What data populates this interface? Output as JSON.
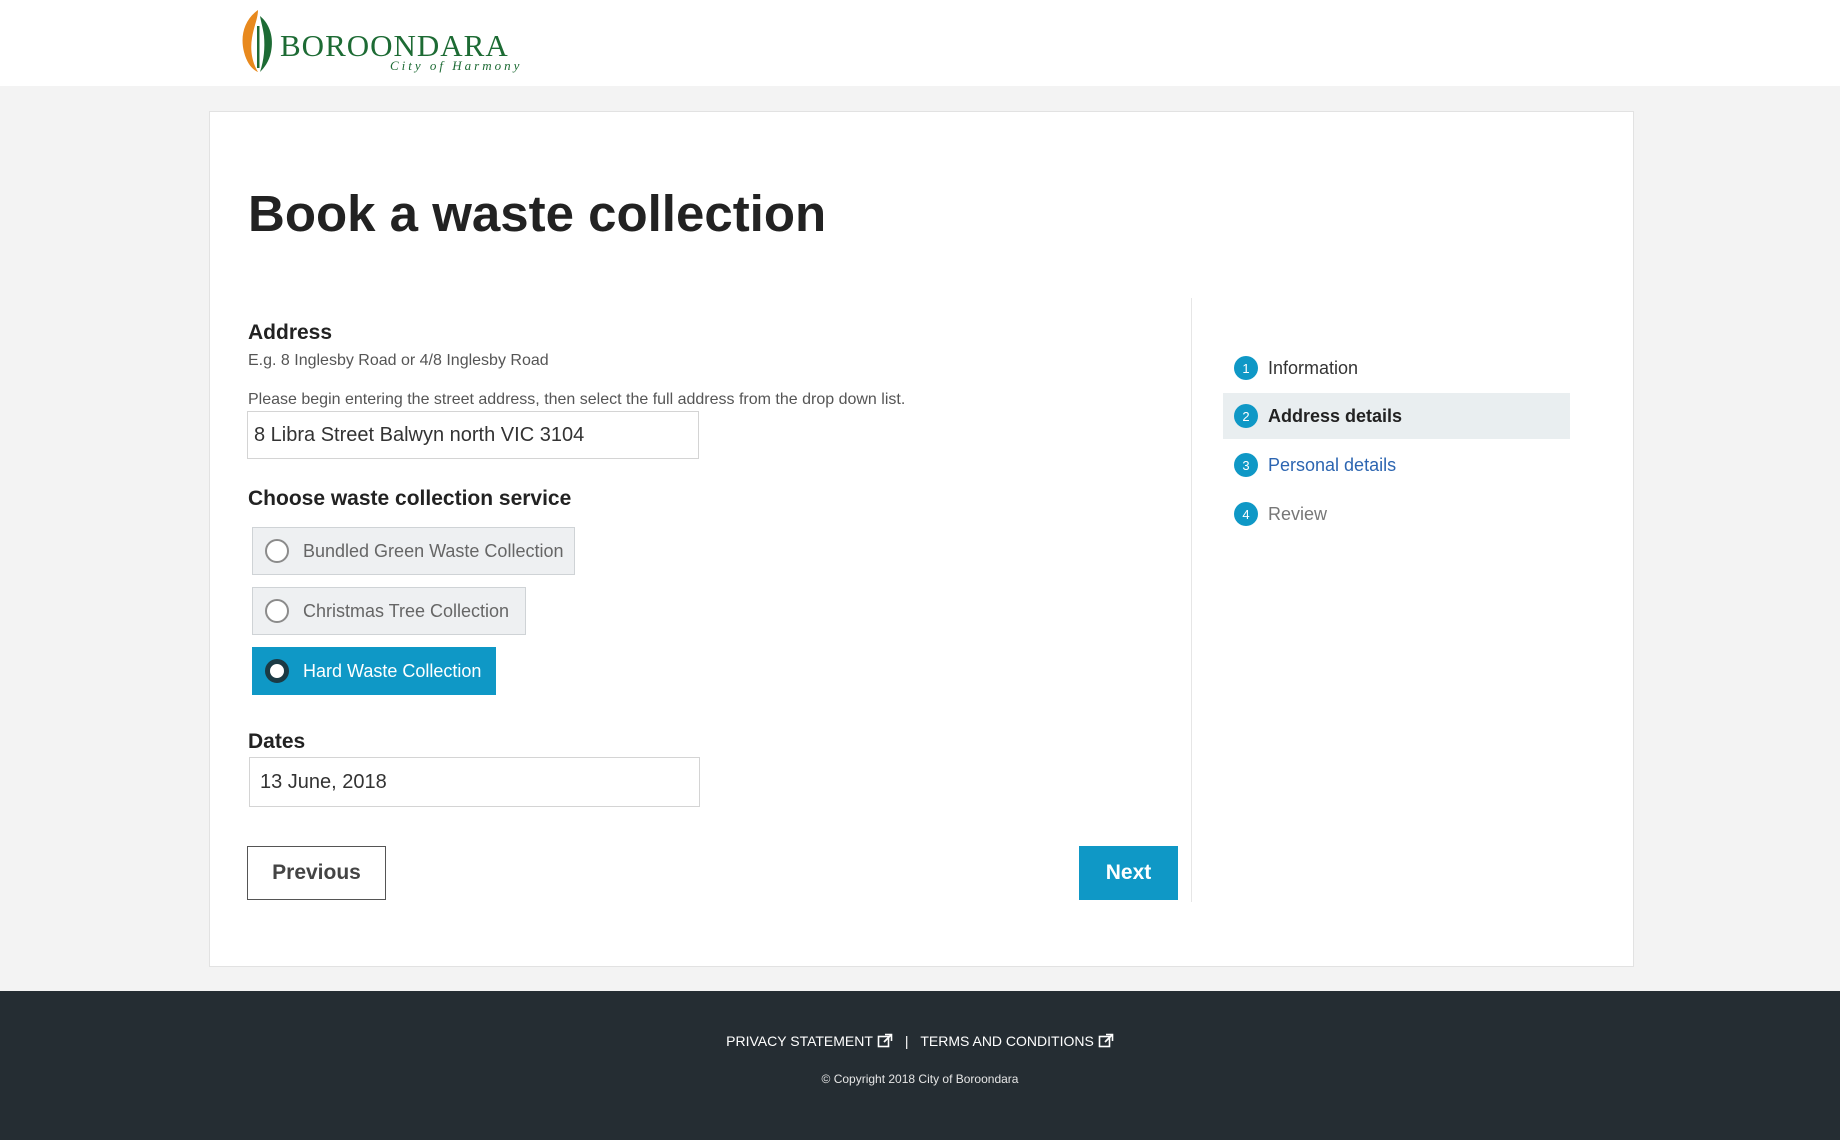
{
  "header": {
    "logo_name": "BOROONDARA",
    "logo_tagline": "City of Harmony"
  },
  "main": {
    "title": "Book a waste collection",
    "address": {
      "label": "Address",
      "example": "E.g. 8 Inglesby Road or 4/8 Inglesby Road",
      "instruction": "Please begin entering the street address, then select the full address from the drop down list.",
      "value": "8 Libra Street Balwyn north VIC 3104"
    },
    "service": {
      "label": "Choose waste collection service",
      "options": [
        {
          "label": "Bundled Green Waste Collection",
          "selected": false
        },
        {
          "label": "Christmas Tree Collection",
          "selected": false
        },
        {
          "label": "Hard Waste Collection",
          "selected": true
        }
      ]
    },
    "dates": {
      "label": "Dates",
      "value": "13 June, 2018"
    },
    "buttons": {
      "previous": "Previous",
      "next": "Next"
    }
  },
  "steps": [
    {
      "number": "1",
      "label": "Information",
      "state": "done"
    },
    {
      "number": "2",
      "label": "Address details",
      "state": "active"
    },
    {
      "number": "3",
      "label": "Personal details",
      "state": "link"
    },
    {
      "number": "4",
      "label": "Review",
      "state": "pending"
    }
  ],
  "footer": {
    "privacy": "PRIVACY STATEMENT",
    "separator": "|",
    "terms": "TERMS AND CONDITIONS",
    "copyright": "© Copyright 2018 City of Boroondara"
  },
  "colors": {
    "accent": "#0f98c6",
    "brand_green": "#1d6b34",
    "brand_orange": "#e8891d",
    "footer_bg": "#252d33",
    "link": "#2c65b1"
  },
  "icons": {
    "external_link": "external-link-icon",
    "radio": "radio-circle-icon"
  }
}
